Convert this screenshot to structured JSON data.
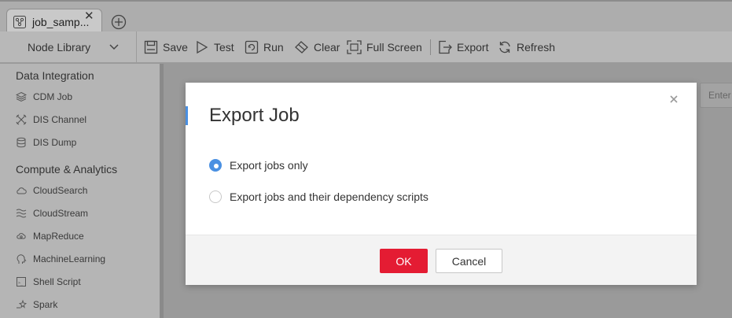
{
  "tabs": [
    {
      "label": "job_samp...",
      "icon": "workflow-icon"
    }
  ],
  "toolbar": {
    "node_library_label": "Node Library",
    "save_label": "Save",
    "test_label": "Test",
    "run_label": "Run",
    "clear_label": "Clear",
    "fullscreen_label": "Full Screen",
    "export_label": "Export",
    "refresh_label": "Refresh"
  },
  "sidebar": {
    "categories": [
      {
        "label": "Data Integration",
        "items": [
          {
            "label": "CDM Job",
            "icon": "cdm-icon"
          },
          {
            "label": "DIS Channel",
            "icon": "dis-channel-icon"
          },
          {
            "label": "DIS Dump",
            "icon": "dis-dump-icon"
          }
        ]
      },
      {
        "label": "Compute & Analytics",
        "items": [
          {
            "label": "CloudSearch",
            "icon": "cloud-icon"
          },
          {
            "label": "CloudStream",
            "icon": "stream-icon"
          },
          {
            "label": "MapReduce",
            "icon": "mapreduce-icon"
          },
          {
            "label": "MachineLearning",
            "icon": "brain-icon"
          },
          {
            "label": "Shell Script",
            "icon": "shell-icon"
          },
          {
            "label": "Spark",
            "icon": "spark-icon"
          }
        ]
      }
    ]
  },
  "search": {
    "placeholder": "Enter"
  },
  "modal": {
    "title": "Export Job",
    "options": [
      {
        "label": "Export jobs only",
        "selected": true
      },
      {
        "label": "Export jobs and their dependency scripts",
        "selected": false
      }
    ],
    "ok_label": "OK",
    "cancel_label": "Cancel"
  },
  "colors": {
    "accent": "#4a90e2",
    "primary_button": "#e41c33"
  }
}
